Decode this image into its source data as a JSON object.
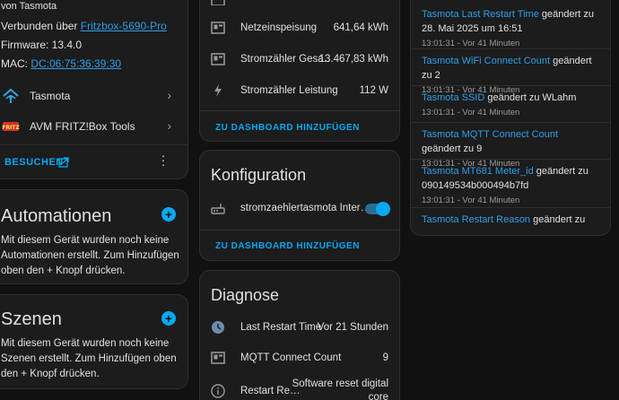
{
  "device_info": {
    "by_line": "von Tasmota",
    "connected_prefix": "Verbunden über",
    "connected_link": "Fritzbox-5690-Pro",
    "firmware": "Firmware: 13.4.0",
    "mac_prefix": "MAC:",
    "mac_link": "DC:06:75:36:39:30",
    "integrations": [
      {
        "label": "Tasmota",
        "icon": "tasmota-icon"
      },
      {
        "label": "AVM FRITZ!Box Tools",
        "icon": "fritzbox-icon"
      }
    ],
    "visit_button": "BESUCHEN"
  },
  "automations": {
    "title": "Automationen",
    "body": "Mit diesem Gerät wurden noch keine Automationen erstellt. Zum Hinzufügen oben den + Knopf drücken."
  },
  "scenes": {
    "title": "Szenen",
    "body": "Mit diesem Gerät wurden noch keine Szenen erstellt. Zum Hinzufügen oben den + Knopf drücken."
  },
  "sensors": {
    "rows": [
      {
        "label": "Netzeinspeisung",
        "value": "641,64 kWh",
        "icon": "meter-icon"
      },
      {
        "label": "Stromzähler Gesa…",
        "value": "13.467,83 kWh",
        "icon": "meter-icon"
      },
      {
        "label": "Stromzähler Leistung",
        "value": "112 W",
        "icon": "lightning-icon"
      }
    ],
    "add_button": "ZU DASHBOARD HINZUFÜGEN"
  },
  "configuration": {
    "title": "Konfiguration",
    "row_label": "stromzaehlertasmota Inter…",
    "toggle_on": true,
    "add_button": "ZU DASHBOARD HINZUFÜGEN"
  },
  "diagnostics": {
    "title": "Diagnose",
    "rows": [
      {
        "label": "Last Restart Time",
        "value": "Vor 21 Stunden",
        "icon": "clock-icon"
      },
      {
        "label": "MQTT Connect Count",
        "value": "9",
        "icon": "meter-icon"
      },
      {
        "label": "Restart Re…",
        "value_line1": "Software reset digital",
        "value_line2": "core",
        "icon": "info-icon"
      }
    ]
  },
  "logbook": [
    {
      "entity": "Tasmota Last Restart Time",
      "message": " geändert zu 28. Mai 2025 um 16:51",
      "time": "13:01:31 - Vor 41 Minuten"
    },
    {
      "entity": "Tasmota WiFi Connect Count",
      "message": " geändert zu 2",
      "time": "13:01:31 - Vor 41 Minuten"
    },
    {
      "entity": "Tasmota SSID",
      "message": " geändert zu WLahm",
      "time": "13:01:31 - Vor 41 Minuten"
    },
    {
      "entity": "Tasmota MQTT Connect Count",
      "message": " geändert zu 9",
      "time": "13:01:31 - Vor 41 Minuten"
    },
    {
      "entity": "Tasmota MT681 Meter_id",
      "message": " geändert zu 090149534b000494b7fd",
      "time": "13:01:31 - Vor 41 Minuten"
    },
    {
      "entity": "Tasmota Restart Reason",
      "message": " geändert zu",
      "time": ""
    }
  ],
  "colors": {
    "accent": "#03a9f4",
    "link": "#2f9ee8",
    "card": "#1c1c1c",
    "background": "#111111"
  }
}
